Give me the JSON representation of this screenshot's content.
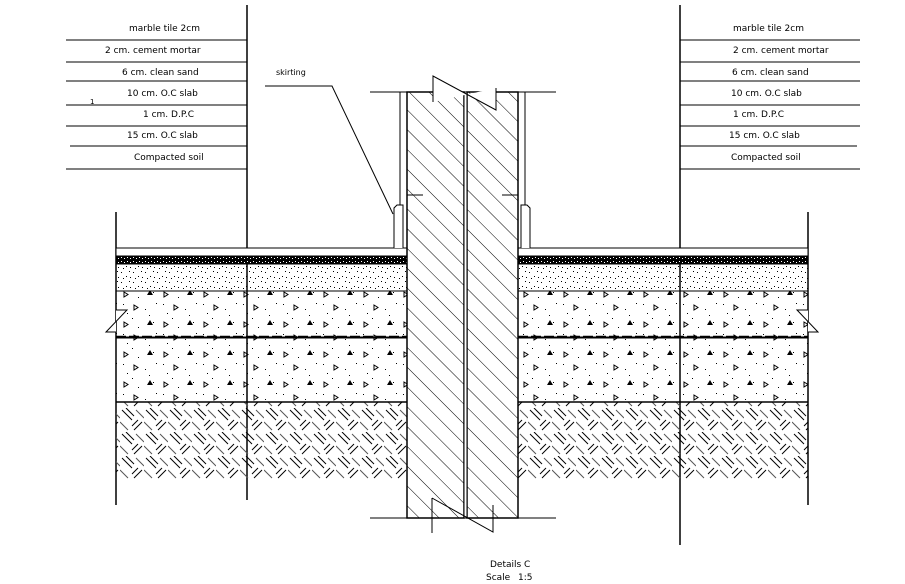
{
  "drawing": {
    "title": "Details C",
    "scale_label": "Scale",
    "scale_value": "1:5",
    "colors": {
      "line": "#000000",
      "background": "#ffffff"
    }
  },
  "legend_left": {
    "layers": [
      "marble tile 2cm",
      "2 cm. cement mortar",
      "6 cm. clean sand",
      "10 cm. O.C slab",
      "1 cm. D.P.C",
      "15 cm. O.C slab",
      "Compacted soil"
    ],
    "marker": "1"
  },
  "legend_right": {
    "layers": [
      "marble tile 2cm",
      "2 cm. cement mortar",
      "6 cm. clean sand",
      "10 cm. O.C slab",
      "1 cm. D.P.C",
      "15 cm. O.C slab",
      "Compacted soil"
    ]
  },
  "annotations": {
    "skirting": "skirting"
  }
}
